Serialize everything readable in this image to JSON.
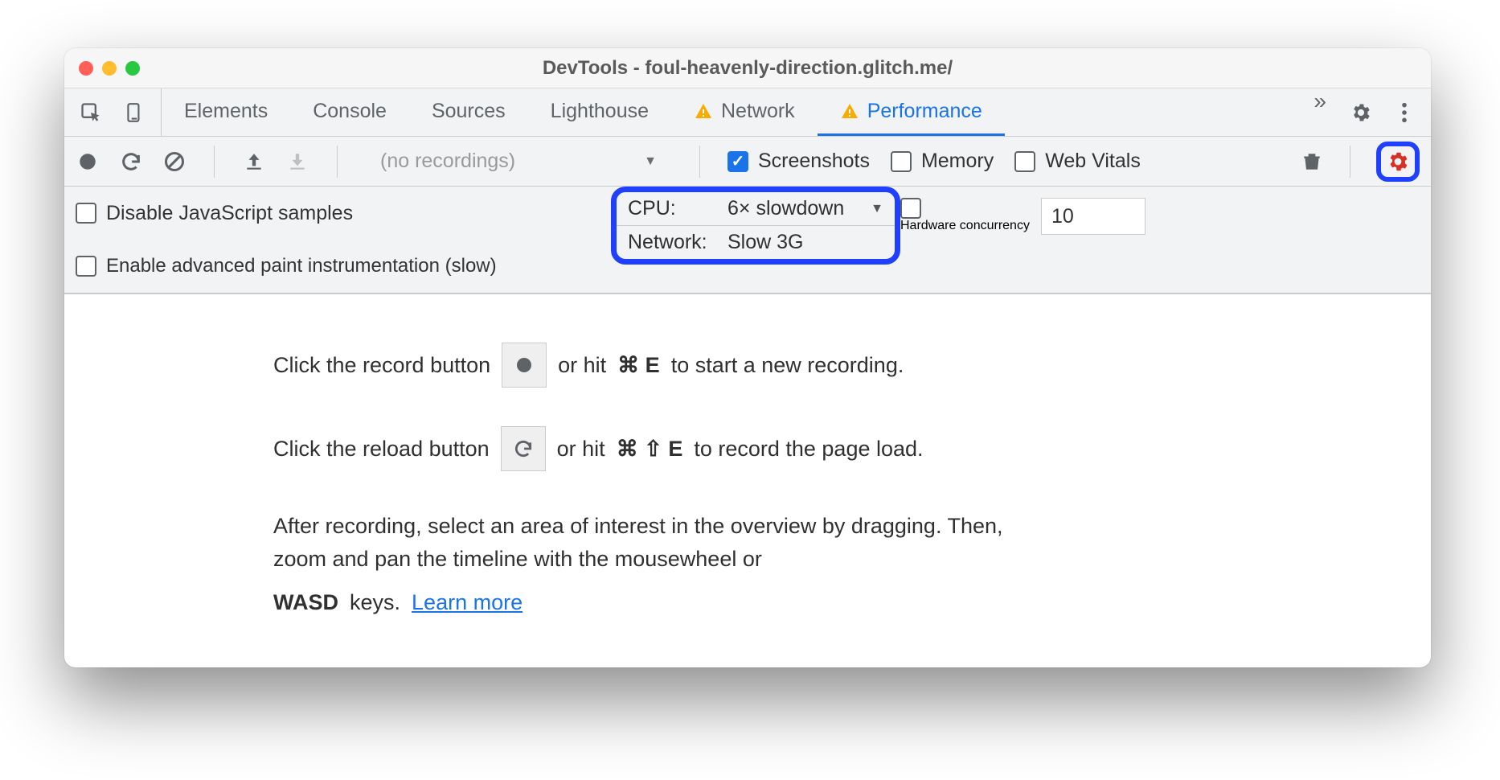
{
  "window": {
    "title": "DevTools - foul-heavenly-direction.glitch.me/"
  },
  "tabs": [
    "Elements",
    "Console",
    "Sources",
    "Lighthouse",
    "Network",
    "Performance"
  ],
  "toolbar": {
    "recordings": "(no recordings)",
    "screenshots": "Screenshots",
    "memory": "Memory",
    "webvitals": "Web Vitals"
  },
  "settings": {
    "disable_js": "Disable JavaScript samples",
    "paint_instr": "Enable advanced paint instrumentation (slow)",
    "cpu_label": "CPU:",
    "cpu_value": "6× slowdown",
    "net_label": "Network:",
    "net_value": "Slow 3G",
    "hw_label": "Hardware concurrency",
    "hw_value": "10"
  },
  "content": {
    "line1a": "Click the record button",
    "line1b": "or hit",
    "kbd1": "⌘ E",
    "line1c": "to start a new recording.",
    "line2a": "Click the reload button",
    "line2b": "or hit",
    "kbd2": "⌘ ⇧ E",
    "line2c": "to record the page load.",
    "line3a": "After recording, select an area of interest in the overview by dragging. Then, zoom and pan the timeline with the mousewheel or",
    "wasd": "WASD",
    "line3b": "keys.",
    "learn_more": "Learn more"
  }
}
